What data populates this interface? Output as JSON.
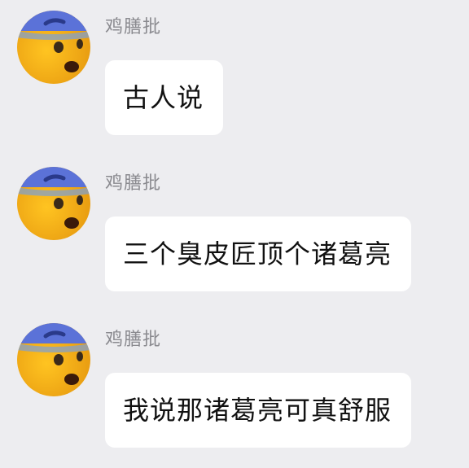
{
  "messages": [
    {
      "sender": "鸡膳批",
      "text": "古人说",
      "avatar_icon": "shocked-emoji-face-icon"
    },
    {
      "sender": "鸡膳批",
      "text": "三个臭皮匠顶个诸葛亮",
      "avatar_icon": "shocked-emoji-face-icon"
    },
    {
      "sender": "鸡膳批",
      "text": "我说那诸葛亮可真舒服",
      "avatar_icon": "shocked-emoji-face-icon"
    }
  ],
  "colors": {
    "background": "#ededf0",
    "bubble": "#ffffff",
    "sender_text": "#8a8a8f",
    "message_text": "#111111",
    "avatar_face": "#f3b316",
    "avatar_band": "#5b72d8"
  }
}
